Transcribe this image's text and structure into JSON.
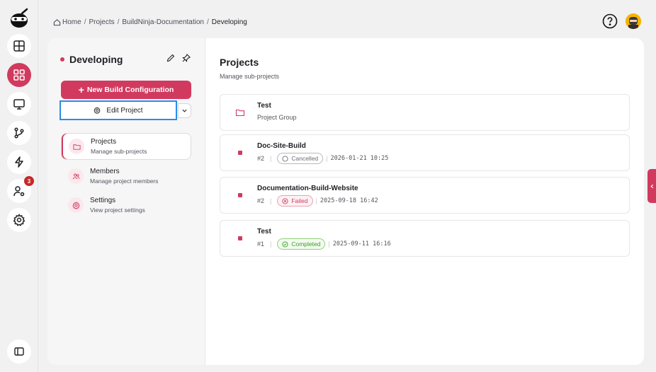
{
  "breadcrumb": {
    "items": [
      "Home",
      "Projects",
      "BuildNinja-Documentation",
      "Developing"
    ],
    "separator": "/"
  },
  "notifications": {
    "badge_count": "3"
  },
  "project": {
    "name": "Developing",
    "new_build_label": "New Build Configuration",
    "edit_label": "Edit Project"
  },
  "nav": [
    {
      "label": "Projects",
      "sub": "Manage sub-projects",
      "icon": "folder-icon"
    },
    {
      "label": "Members",
      "sub": "Manage project members",
      "icon": "users-icon"
    },
    {
      "label": "Settings",
      "sub": "View project settings",
      "icon": "gear-icon"
    }
  ],
  "main": {
    "title": "Projects",
    "subtitle": "Manage sub-projects",
    "items": [
      {
        "kind": "group",
        "title": "Test",
        "sub": "Project Group"
      },
      {
        "kind": "build",
        "title": "Doc-Site-Build",
        "number": "#2",
        "status": "Cancelled",
        "date": "2026-01-21 10:25"
      },
      {
        "kind": "build",
        "title": "Documentation-Build-Website",
        "number": "#2",
        "status": "Failed",
        "date": "2025-09-18 16:42"
      },
      {
        "kind": "build",
        "title": "Test",
        "number": "#1",
        "status": "Completed",
        "date": "2025-09-11 16:16"
      }
    ]
  },
  "colors": {
    "accent": "#d13a5e",
    "focus": "#2b8ce6",
    "success": "#3d9b28"
  }
}
